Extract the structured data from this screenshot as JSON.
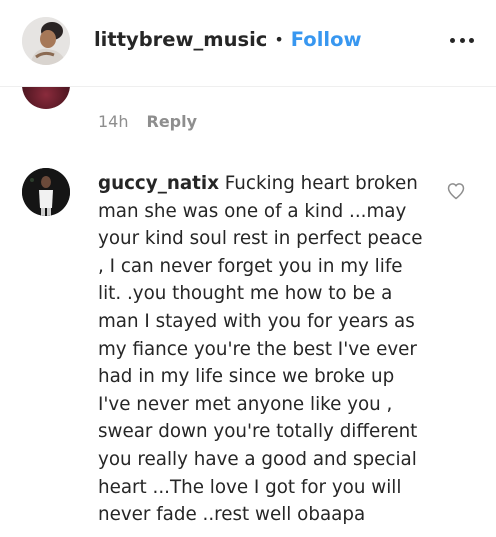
{
  "header": {
    "username": "littybrew_music",
    "separator": "•",
    "follow_label": "Follow",
    "more_icon": "more-horizontal-icon"
  },
  "previous_comment": {
    "time": "14h",
    "reply_label": "Reply"
  },
  "comment": {
    "username": "guccy_natix",
    "text": "Fucking heart broken man she was one of a kind ...may your kind soul rest in perfect peace , I can never forget you in my life lit. .you thought me how to be a man I stayed with you for years as my fiance you're the best I've ever had in my life since we broke up I've never met anyone like you , swear down you're totally different you really have a good and special heart ...The love I got for you will never fade ..rest well obaapa",
    "like_icon": "heart-outline-icon"
  },
  "colors": {
    "link_blue": "#3897f0",
    "text_primary": "#262626",
    "text_secondary": "#8e8e8e"
  }
}
